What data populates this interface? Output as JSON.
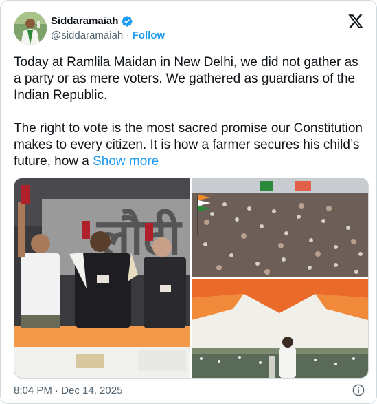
{
  "author": {
    "display_name": "Siddaramaiah",
    "handle": "@siddaramaiah",
    "separator": " · ",
    "follow_label": "Follow"
  },
  "tweet": {
    "body": "Today at Ramlila Maidan in New Delhi, we did not gather as a party or as mere voters. We gathered as guardians of the Indian Republic.\n\nThe right to vote is the most sacred promise our Constitution makes to every citizen. It is how a farmer secures his child’s future, how a ",
    "show_more_label": "Show more"
  },
  "media": {
    "photo1_banner_text": "लौटी",
    "photo3_note": ""
  },
  "footer": {
    "timestamp": "8:04 PM · Dec 14, 2025"
  },
  "colors": {
    "link": "#1d9bf0",
    "verified": "#1d9bf0",
    "secondary_text": "#536471"
  },
  "icons": [
    "verified-badge-icon",
    "x-logo-icon",
    "info-icon"
  ]
}
